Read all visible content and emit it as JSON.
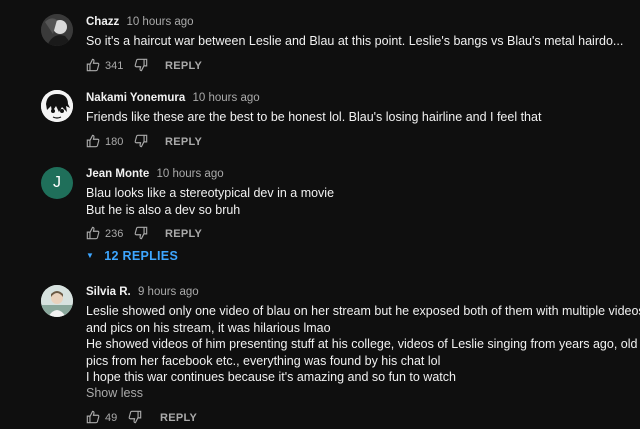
{
  "comments": [
    {
      "author": "Chazz",
      "time": "10 hours ago",
      "lines": [
        "So it's a haircut war between Leslie and Blau at this point. Leslie's bangs vs Blau's metal hairdo..."
      ],
      "likes": "341",
      "reply_label": "REPLY",
      "avatar_icon": "photo-avatar-dark"
    },
    {
      "author": "Nakami Yonemura",
      "time": "10 hours ago",
      "lines": [
        "Friends like these are the best to be honest lol. Blau's losing hairline and I feel that"
      ],
      "likes": "180",
      "reply_label": "REPLY",
      "avatar_icon": "anime-face-avatar"
    },
    {
      "author": "Jean Monte",
      "time": "10 hours ago",
      "lines": [
        "Blau looks like a stereotypical  dev in a movie",
        "But he is also a dev so bruh"
      ],
      "likes": "236",
      "reply_label": "REPLY",
      "avatar_letter": "J",
      "avatar_color": "#1f6f5a",
      "replies_label": "12 REPLIES"
    },
    {
      "author": "Silvia R.",
      "time": "9 hours ago",
      "lines": [
        "Leslie showed only one video of blau on her stream but he exposed both of them with multiple videos",
        "and pics on his stream, it was hilarious lmao",
        "He showed videos of him presenting stuff at his college, videos of Leslie singing from years ago, old",
        "pics from her facebook etc., everything was found by his chat lol",
        "I hope this war continues because it's amazing and so fun to watch"
      ],
      "show_less_label": "Show less",
      "likes": "49",
      "reply_label": "REPLY",
      "avatar_icon": "photo-avatar-light"
    }
  ],
  "colors": {
    "background": "#0f0f0f",
    "text": "#f1f1f1",
    "secondary": "#aaaaaa",
    "link": "#3ea6ff"
  }
}
